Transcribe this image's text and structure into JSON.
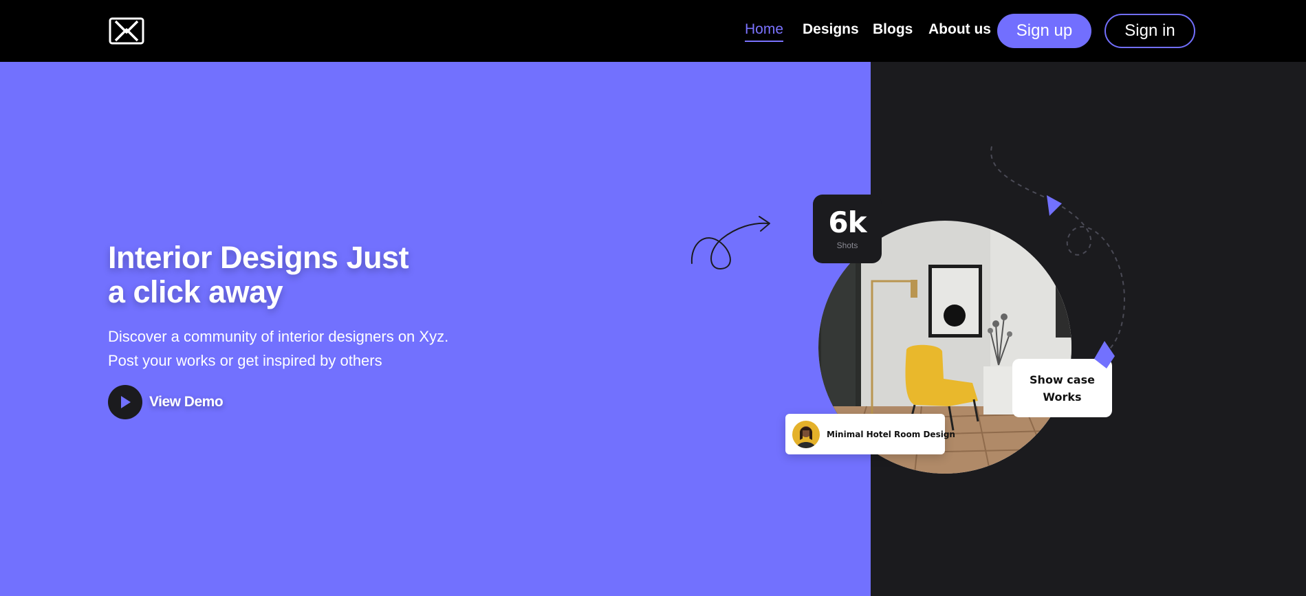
{
  "header": {
    "logo_icon": "x-logo-icon",
    "nav": [
      "Home",
      "Designs",
      "Blogs",
      "About us"
    ],
    "active": "Home",
    "signup_label": "Sign up",
    "signin_label": "Sign in"
  },
  "hero": {
    "title_line1": "Interior Designs Just",
    "title_line2": "a click away",
    "subtitle_line1": "Discover a community of interior designers on Xyz.",
    "subtitle_line2": "Post your works or get inspired by others",
    "demo_label": "View Demo",
    "demo_icon": "play-icon"
  },
  "showcase": {
    "shots_value": "6k",
    "shots_label": "Shots",
    "card_line1": "Show case",
    "card_line2": "Works",
    "hotel_title": "Minimal Hotel Room Design"
  },
  "colors": {
    "accent": "#7271fe",
    "dark": "#1b1b1e",
    "header_bg": "#000000"
  }
}
